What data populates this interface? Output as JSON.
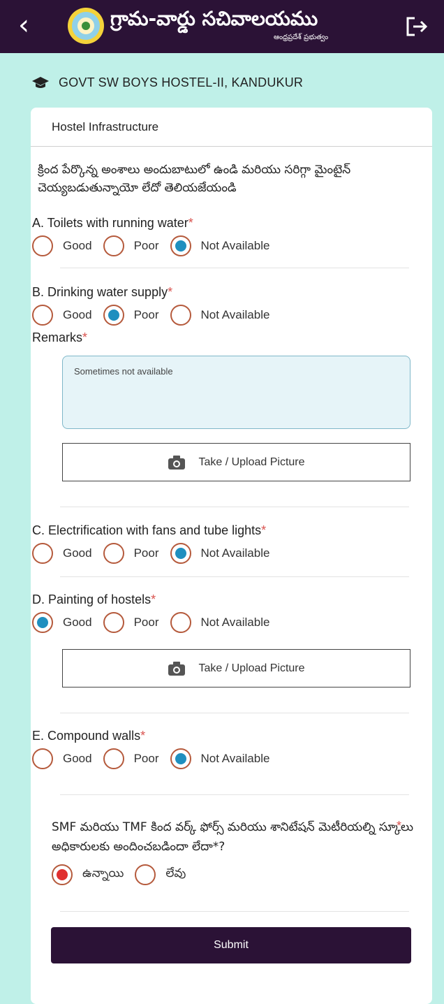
{
  "header": {
    "title": "గ్రామ-వార్డు సచివాలయము",
    "subtitle": "ఆంధ్రప్రదేశ్ ప్రభుత్వం",
    "back_icon": "chevron-left-icon",
    "logout_icon": "logout-icon"
  },
  "hostel": {
    "name": "GOVT SW BOYS HOSTEL-II, KANDUKUR"
  },
  "card": {
    "title": "Hostel Infrastructure",
    "instruction": "క్రింద పేర్కొన్న అంశాలు అందుబాటులో ఉండి మరియు సరిగ్గా మైంటైన్ చెయ్యబడుతున్నాయో లేదో తెలియజేయండి"
  },
  "options": {
    "good": "Good",
    "poor": "Poor",
    "na": "Not Available"
  },
  "questions": {
    "a": {
      "title": "A. Toilets with running water",
      "selected": "Not Available"
    },
    "b": {
      "title": "B. Drinking water supply",
      "selected": "Poor",
      "remarks_label": "Remarks",
      "remarks_value": "Sometimes not available"
    },
    "c": {
      "title": "C. Electrification with fans and tube lights",
      "selected": "Not Available"
    },
    "d": {
      "title": "D. Painting of hostels",
      "selected": "Good"
    },
    "e": {
      "title": "E. Compound walls",
      "selected": "Not Available"
    }
  },
  "required_mark": "*",
  "upload": {
    "label": "Take / Upload Picture"
  },
  "smf": {
    "question": "SMF మరియు TMF కింద వర్క్ ఫోర్స్ మరియు శానిటేషన్ మెటీరియల్ని స్కూలు అధికారులకు అందించబడిందా లేదా*?",
    "yes": "ఉన్నాయి",
    "no": "లేవు",
    "selected": "ఉన్నాయి"
  },
  "submit": {
    "label": "Submit"
  },
  "colors": {
    "header_bg": "#2b1236",
    "page_bg": "#bff0e8",
    "radio_selected": "#1f8fbf",
    "radio_border": "#b55a3c"
  }
}
